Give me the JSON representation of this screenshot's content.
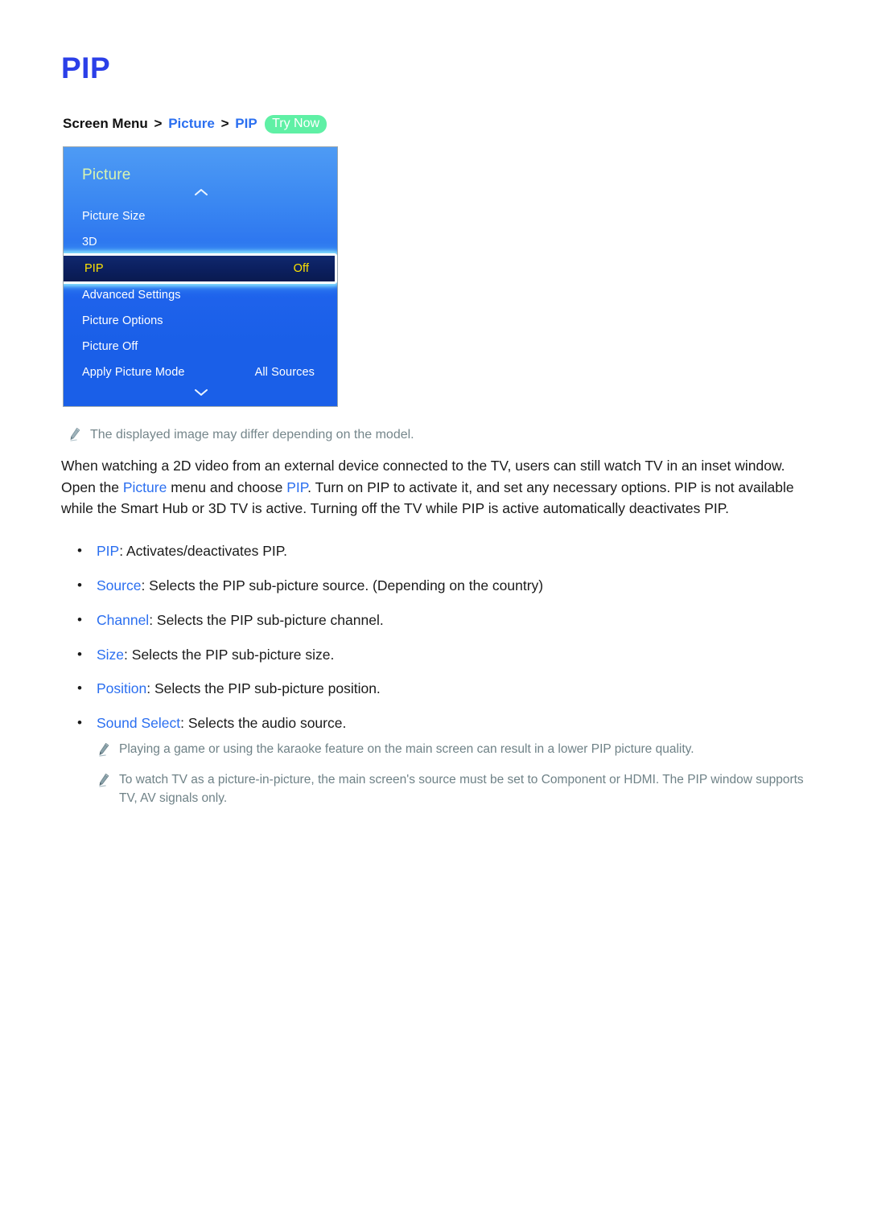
{
  "document": {
    "title": "PIP",
    "breadcrumb": {
      "root": "Screen Menu",
      "sep1": ">",
      "level1": "Picture",
      "sep2": ">",
      "level2": "PIP",
      "badge": "Try Now"
    },
    "accent_blue": "#2b6ff0",
    "title_blue": "#2b3fe8",
    "badge_green": "#5ff0a5",
    "note_gray": "#6f8287"
  },
  "tv_menu": {
    "header": "Picture",
    "scroll_up_icon": "chevron-up-icon",
    "scroll_down_icon": "chevron-down-icon",
    "rows": [
      {
        "label": "Picture Size",
        "value": "",
        "selected": false
      },
      {
        "label": "3D",
        "value": "",
        "selected": false
      },
      {
        "label": "PIP",
        "value": "Off",
        "selected": true
      },
      {
        "label": "Advanced Settings",
        "value": "",
        "selected": false
      },
      {
        "label": "Picture Options",
        "value": "",
        "selected": false
      },
      {
        "label": "Picture Off",
        "value": "",
        "selected": false
      },
      {
        "label": "Apply Picture Mode",
        "value": "All Sources",
        "selected": false
      }
    ],
    "selected_text_color": "#ffe400",
    "panel_gradient_top": "#4e9bf4",
    "panel_gradient_bottom": "#1a5fe8"
  },
  "notes": {
    "top": "The displayed image may differ depending on the model.",
    "bottom_1": "Playing a game or using the karaoke feature on the main screen can result in a lower PIP picture quality.",
    "bottom_2": "To watch TV as a picture-in-picture, the main screen's source must be set to Component or HDMI. The PIP window supports TV, AV signals only."
  },
  "paragraph": {
    "part1": "When watching a 2D video from an external device connected to the TV, users can still watch TV in an inset window. Open the ",
    "link1": "Picture",
    "part2": " menu and choose ",
    "link2": "PIP",
    "part3": ". Turn on PIP to activate it, and set any necessary options. PIP is not available while the Smart Hub or 3D TV is active. Turning off the TV while PIP is active automatically deactivates PIP."
  },
  "bullets": [
    {
      "marker": "•",
      "term": "PIP",
      "desc": ": Activates/deactivates PIP."
    },
    {
      "marker": "•",
      "term": "Source",
      "desc": ": Selects the PIP sub-picture source. (Depending on the country)"
    },
    {
      "marker": "•",
      "term": "Channel",
      "desc": ": Selects the PIP sub-picture channel."
    },
    {
      "marker": "•",
      "term": "Size",
      "desc": ": Selects the PIP sub-picture size."
    },
    {
      "marker": "•",
      "term": "Position",
      "desc": ": Selects the PIP sub-picture position."
    },
    {
      "marker": "•",
      "term": "Sound Select",
      "desc": ": Selects the audio source."
    }
  ]
}
